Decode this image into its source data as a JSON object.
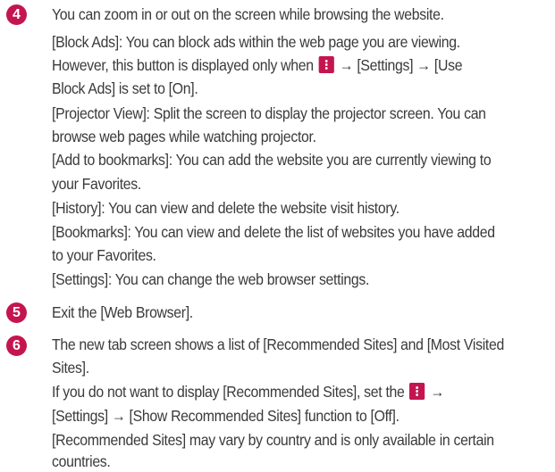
{
  "items": [
    {
      "number": "4",
      "lines": [
        "You can zoom in or out on the screen while browsing the website.",
        "[Block Ads]: You can block ads within the web page you are viewing.",
        [
          "However, this button is displayed only when ",
          " → [Settings] → [Use"
        ],
        "Block Ads] is set to [On].",
        "[Projector View]: Split the screen to display the projector screen. You can",
        "browse web pages while watching projector.",
        "[Add to bookmarks]: You can add the website you are currently viewing to",
        "your Favorites.",
        "[History]: You can view and delete the website visit history.",
        "[Bookmarks]: You can view and delete the list of websites you have added",
        "to your Favorites.",
        "[Settings]: You can change the web browser settings."
      ]
    },
    {
      "number": "5",
      "lines": [
        "Exit the [Web Browser]."
      ]
    },
    {
      "number": "6",
      "lines": [
        "The new tab screen shows a list of [Recommended Sites] and [Most Visited",
        "Sites].",
        [
          "If you do not want to display [Recommended Sites], set the ",
          " →"
        ],
        "[Settings] → [Show Recommended Sites] function to [Off].",
        "[Recommended Sites] may vary by country and is only available in certain",
        "countries."
      ]
    }
  ],
  "colors": {
    "accent": "#c4154f",
    "text": "#3a3a3a"
  },
  "icons": {
    "inline_menu": "more-vertical-icon"
  }
}
